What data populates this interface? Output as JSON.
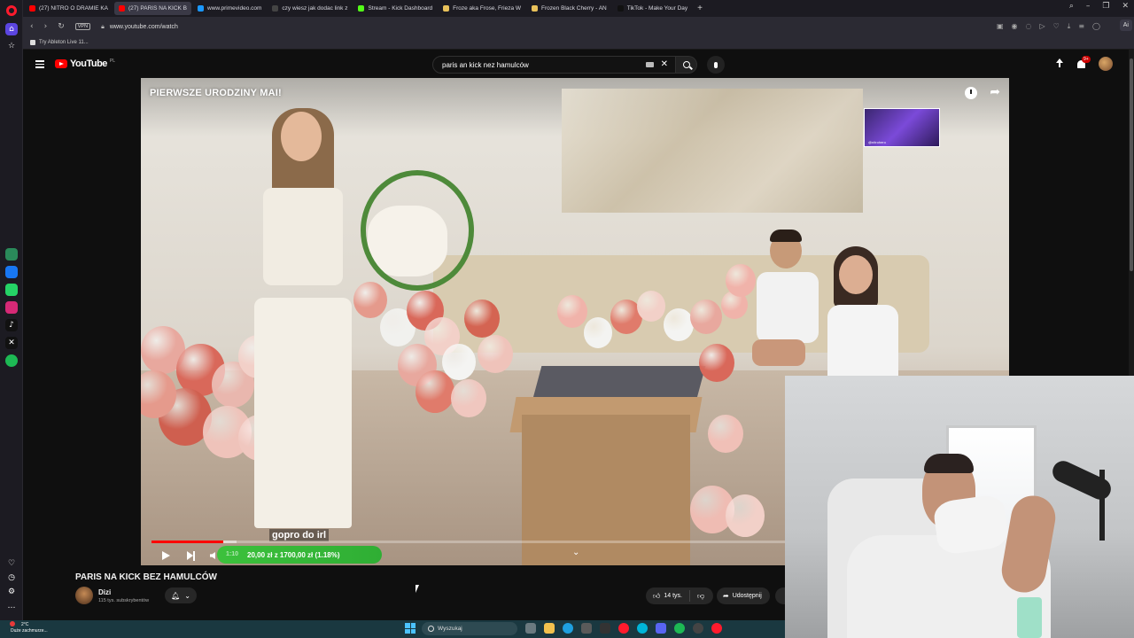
{
  "browser": {
    "tabs": [
      {
        "label": "(27) NITRO O DRAMIE KA",
        "color": "#ff0000",
        "active": false
      },
      {
        "label": "(27) PARIS NA KICK B",
        "color": "#ff0000",
        "active": true
      },
      {
        "label": "www.primevideo.com",
        "color": "#1a98ff",
        "active": false
      },
      {
        "label": "czy wiesz jak dodac link z",
        "color": "#444444",
        "active": false
      },
      {
        "label": "Stream - Kick Dashboard",
        "color": "#53fc18",
        "active": false
      },
      {
        "label": "Froze aka Frose, Frieza W",
        "color": "#e8c15a",
        "active": false
      },
      {
        "label": "Frozen Black Cherry - AN",
        "color": "#e8c15a",
        "active": false
      },
      {
        "label": "TikTok - Make Your Day",
        "color": "#111111",
        "active": false
      }
    ],
    "new_tab": "+",
    "url": "www.youtube.com/watch",
    "vpn_label": "VPN",
    "ai_label": "Ai",
    "bookmark": "Try Ableton Live 11..."
  },
  "youtube": {
    "logo_text": "YouTube",
    "country_code": "PL",
    "search_value": "paris an kick nez hamulców",
    "notification_count": "9+",
    "video": {
      "title_overlay": "PIERWSZE URODZINY MAI!",
      "caption": "gopro do irl",
      "progress_played": 0.084,
      "progress_buffered": 0.1,
      "donation_time": "1:10",
      "donation_text": "20,00 zł z 1700,00 zł (1.18%)",
      "donation_fraction": 0.0118,
      "overlay_label": "@nitrohero"
    },
    "heading": "PARIS NA KICK BEZ HAMULCÓW",
    "channel": {
      "name": "Dizi",
      "subscribers": "115 tys. subskrybentów"
    },
    "likes": "14 tys.",
    "share_label": "Udostępnij"
  },
  "taskbar": {
    "weather_temp": "2°C",
    "weather_desc": "Duże zachmurze...",
    "search_placeholder": "Wyszukaj"
  },
  "colors": {
    "yt_red": "#ff0000",
    "donation_green": "#3cc13c",
    "opera_red": "#ff1b2d",
    "taskbar": "#1a3840"
  }
}
